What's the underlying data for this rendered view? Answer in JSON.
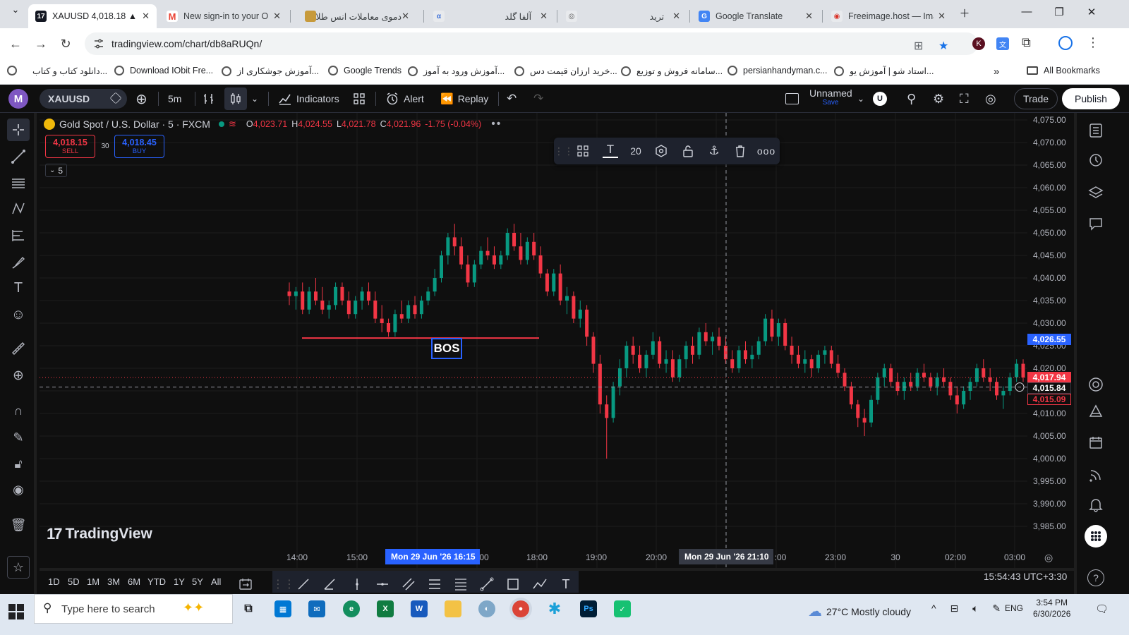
{
  "browser": {
    "tabs": [
      {
        "title": "XAUUSD 4,018.18 ▲ +",
        "favicon": "tradingview-icon",
        "active": true
      },
      {
        "title": "New sign-in to your O",
        "favicon": "gmail-icon"
      },
      {
        "title": "دموی معاملات انس طلا",
        "favicon": "site-icon"
      },
      {
        "title": "آلفا گلد",
        "favicon": "site-icon"
      },
      {
        "title": "ترید",
        "favicon": "site-icon"
      },
      {
        "title": "Google Translate",
        "favicon": "translate-icon"
      },
      {
        "title": "Freeimage.host — Ima",
        "favicon": "site-icon"
      }
    ],
    "url": "tradingview.com/chart/db8aRUQn/",
    "bookmarks": [
      "دانلود کتاب و کتاب...",
      "Download IObit Fre...",
      "آموزش جوشکاری از...",
      "Google Trends",
      "آموزش ورود به آموز...",
      "خرید ارزان قیمت دس...",
      "سامانه فروش و توزیع...",
      "persianhandyman.c...",
      "استاد شو | آموزش یو..."
    ],
    "all_bookmarks": "All Bookmarks"
  },
  "tv": {
    "avatar_letter": "M",
    "symbol": "XAUUSD",
    "interval": "5m",
    "indicators_label": "Indicators",
    "alert_label": "Alert",
    "replay_label": "Replay",
    "layout_name": "Unnamed",
    "layout_save": "Save",
    "user_badge": "U",
    "trade_label": "Trade",
    "publish_label": "Publish"
  },
  "legend": {
    "title": "Gold Spot / U.S. Dollar · 5 · FXCM",
    "o_key": "O",
    "o": "4,023.71",
    "h_key": "H",
    "h": "4,024.55",
    "l_key": "L",
    "l": "4,021.78",
    "c_key": "C",
    "c": "4,021.96",
    "change": "-1.75 (-0.04%)"
  },
  "trade_panel": {
    "sell_price": "4,018.15",
    "sell_label": "SELL",
    "spread": "30",
    "buy_price": "4,018.45",
    "buy_label": "BUY",
    "collapse_count": "5"
  },
  "drawing_toolbar": {
    "font_size": "20"
  },
  "annotation": {
    "label": "BOS",
    "level": 4026.7,
    "color": "#f23645"
  },
  "watermark": "TradingView",
  "price_axis": {
    "ticks": [
      "4,075.00",
      "4,070.00",
      "4,065.00",
      "4,060.00",
      "4,055.00",
      "4,050.00",
      "4,045.00",
      "4,040.00",
      "4,035.00",
      "4,030.00",
      "4,025.00",
      "4,020.00",
      "4,015.00",
      "4,010.00",
      "4,005.00",
      "4,000.00",
      "3,995.00",
      "3,990.00",
      "3,985.00"
    ],
    "badges": [
      {
        "text": "4,026.55",
        "bg": "#2962ff",
        "fg": "#ffffff"
      },
      {
        "text": "4,017.94",
        "bg": "#f23645",
        "fg": "#ffffff"
      },
      {
        "text": "4,015.84",
        "bg": "#0f0f0f",
        "fg": "#ffffff"
      },
      {
        "text": "4,015.09",
        "bg": "#0f0f0f",
        "fg": "#f23645"
      }
    ]
  },
  "time_axis": {
    "ticks": [
      "14:00",
      "15:00",
      "18:00",
      "19:00",
      "20:00",
      "23:00",
      "30",
      "02:00",
      "03:00"
    ],
    "partial_ticks": [
      "00",
      ":00"
    ],
    "crosshair_label": "Mon 29 Jun '26   21:10",
    "highlight_label": "Mon 29 Jun '26   16:15"
  },
  "ranges": [
    "1D",
    "5D",
    "1M",
    "3M",
    "6M",
    "YTD",
    "1Y",
    "5Y",
    "All"
  ],
  "clock": "15:54:43 UTC+3:30",
  "taskbar": {
    "search_placeholder": "Type here to search",
    "weather": "27°C  Mostly cloudy",
    "lang": "ENG",
    "time": "3:54 PM",
    "date": "6/30/2026"
  },
  "colors": {
    "up": "#089981",
    "down": "#f23645",
    "accent": "#2962ff"
  },
  "chart_data": {
    "type": "candlestick",
    "ylim": [
      3983,
      4077
    ],
    "candles": [
      [
        4037,
        4039,
        4034,
        4036
      ],
      [
        4036,
        4038,
        4033,
        4037
      ],
      [
        4037,
        4039,
        4032,
        4033
      ],
      [
        4033,
        4038,
        4032,
        4037
      ],
      [
        4037,
        4040,
        4034,
        4035
      ],
      [
        4035,
        4038,
        4032,
        4033
      ],
      [
        4033,
        4035,
        4031,
        4034
      ],
      [
        4034,
        4039,
        4033,
        4038
      ],
      [
        4038,
        4039,
        4034,
        4035
      ],
      [
        4035,
        4037,
        4031,
        4032
      ],
      [
        4032,
        4036,
        4031,
        4035
      ],
      [
        4035,
        4038,
        4033,
        4037
      ],
      [
        4037,
        4039,
        4034,
        4035
      ],
      [
        4035,
        4037,
        4030,
        4031
      ],
      [
        4031,
        4034,
        4028,
        4030
      ],
      [
        4030,
        4031,
        4027,
        4028
      ],
      [
        4028,
        4033,
        4027,
        4032
      ],
      [
        4032,
        4035,
        4030,
        4031
      ],
      [
        4031,
        4035,
        4030,
        4034
      ],
      [
        4034,
        4036,
        4031,
        4032
      ],
      [
        4032,
        4036,
        4031,
        4035
      ],
      [
        4035,
        4038,
        4034,
        4037
      ],
      [
        4037,
        4042,
        4036,
        4040
      ],
      [
        4040,
        4046,
        4039,
        4045
      ],
      [
        4045,
        4050,
        4043,
        4049
      ],
      [
        4049,
        4052,
        4045,
        4047
      ],
      [
        4047,
        4049,
        4042,
        4043
      ],
      [
        4043,
        4045,
        4038,
        4039
      ],
      [
        4039,
        4044,
        4038,
        4043
      ],
      [
        4043,
        4047,
        4042,
        4046
      ],
      [
        4046,
        4049,
        4044,
        4045
      ],
      [
        4045,
        4047,
        4042,
        4043
      ],
      [
        4043,
        4046,
        4042,
        4045
      ],
      [
        4045,
        4051,
        4044,
        4050
      ],
      [
        4050,
        4052,
        4046,
        4047
      ],
      [
        4047,
        4050,
        4043,
        4044
      ],
      [
        4044,
        4049,
        4043,
        4048
      ],
      [
        4048,
        4050,
        4044,
        4045
      ],
      [
        4045,
        4047,
        4040,
        4041
      ],
      [
        4041,
        4042,
        4036,
        4037
      ],
      [
        4037,
        4042,
        4036,
        4041
      ],
      [
        4041,
        4043,
        4034,
        4035
      ],
      [
        4035,
        4038,
        4032,
        4036
      ],
      [
        4036,
        4037,
        4030,
        4031
      ],
      [
        4031,
        4035,
        4029,
        4033
      ],
      [
        4033,
        4034,
        4025,
        4027
      ],
      [
        4027,
        4028,
        4019,
        4021
      ],
      [
        4021,
        4023,
        4010,
        4012
      ],
      [
        4012,
        4014,
        4000,
        4009
      ],
      [
        4009,
        4017,
        4008,
        4016
      ],
      [
        4016,
        4022,
        4014,
        4020
      ],
      [
        4020,
        4026,
        4018,
        4025
      ],
      [
        4025,
        4027,
        4021,
        4023
      ],
      [
        4023,
        4025,
        4019,
        4020
      ],
      [
        4020,
        4024,
        4018,
        4023
      ],
      [
        4023,
        4028,
        4022,
        4026
      ],
      [
        4026,
        4027,
        4020,
        4021
      ],
      [
        4021,
        4024,
        4019,
        4022
      ],
      [
        4022,
        4024,
        4017,
        4018
      ],
      [
        4018,
        4023,
        4017,
        4022
      ],
      [
        4022,
        4026,
        4020,
        4025
      ],
      [
        4025,
        4027,
        4021,
        4023
      ],
      [
        4023,
        4029,
        4022,
        4028
      ],
      [
        4028,
        4030,
        4025,
        4026
      ],
      [
        4026,
        4028,
        4023,
        4027
      ],
      [
        4027,
        4029,
        4024,
        4025
      ],
      [
        4025,
        4027,
        4021,
        4022
      ],
      [
        4022,
        4024,
        4019,
        4020
      ],
      [
        4020,
        4025,
        4019,
        4024
      ],
      [
        4024,
        4026,
        4021,
        4022
      ],
      [
        4022,
        4025,
        4020,
        4023
      ],
      [
        4023,
        4027,
        4022,
        4026
      ],
      [
        4026,
        4032,
        4025,
        4031
      ],
      [
        4031,
        4033,
        4026,
        4027
      ],
      [
        4027,
        4031,
        4025,
        4030
      ],
      [
        4030,
        4031,
        4024,
        4025
      ],
      [
        4025,
        4027,
        4021,
        4023
      ],
      [
        4023,
        4025,
        4020,
        4021
      ],
      [
        4021,
        4024,
        4019,
        4022
      ],
      [
        4022,
        4023,
        4018,
        4020
      ],
      [
        4020,
        4024,
        4019,
        4023
      ],
      [
        4023,
        4025,
        4021,
        4024
      ],
      [
        4024,
        4025,
        4020,
        4021
      ],
      [
        4021,
        4023,
        4018,
        4019
      ],
      [
        4019,
        4020,
        4015,
        4016
      ],
      [
        4016,
        4017,
        4011,
        4012
      ],
      [
        4012,
        4013,
        4007,
        4009
      ],
      [
        4009,
        4011,
        4005,
        4008
      ],
      [
        4008,
        4014,
        4007,
        4013
      ],
      [
        4013,
        4019,
        4012,
        4018
      ],
      [
        4018,
        4021,
        4016,
        4020
      ],
      [
        4020,
        4021,
        4016,
        4017
      ],
      [
        4017,
        4019,
        4014,
        4015
      ],
      [
        4015,
        4018,
        4013,
        4017
      ],
      [
        4017,
        4019,
        4015,
        4016
      ],
      [
        4016,
        4020,
        4015,
        4019
      ],
      [
        4019,
        4021,
        4017,
        4018
      ],
      [
        4018,
        4019,
        4015,
        4016
      ],
      [
        4016,
        4019,
        4014,
        4018
      ],
      [
        4018,
        4020,
        4016,
        4017
      ],
      [
        4017,
        4018,
        4013,
        4014
      ],
      [
        4014,
        4016,
        4010,
        4012
      ],
      [
        4012,
        4016,
        4011,
        4015
      ],
      [
        4015,
        4018,
        4013,
        4017
      ],
      [
        4017,
        4021,
        4016,
        4020
      ],
      [
        4020,
        4022,
        4017,
        4018
      ],
      [
        4018,
        4020,
        4015,
        4017
      ],
      [
        4017,
        4018,
        4013,
        4014
      ],
      [
        4014,
        4016,
        4011,
        4015
      ],
      [
        4015,
        4019,
        4014,
        4018
      ],
      [
        4018,
        4022,
        4017,
        4021
      ],
      [
        4021,
        4022,
        4017,
        4018
      ]
    ]
  }
}
